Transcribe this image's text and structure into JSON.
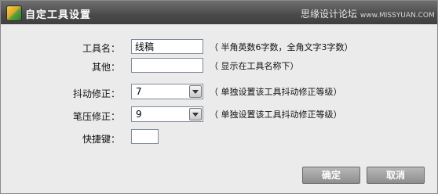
{
  "window": {
    "title": "自定工具设置",
    "watermark": "思缘设计论坛",
    "watermark_sub": "www.MISSYUAN.COM"
  },
  "form": {
    "tool_name": {
      "label": "工具名：",
      "value": "线稿",
      "hint": "（ 半角英数6字数，全角文字3字数）"
    },
    "other": {
      "label": "其他：",
      "value": "",
      "hint": "（ 显示在工具名称下）"
    },
    "stabilizer": {
      "label": "抖动修正：",
      "value": "7",
      "hint": "（ 单独设置该工具抖动修正等级）"
    },
    "pressure": {
      "label": "笔压修正：",
      "value": "9",
      "hint": "（ 单独设置该工具抖动修正等级）"
    },
    "shortcut": {
      "label": "快捷键：",
      "value": ""
    }
  },
  "buttons": {
    "ok": "确定",
    "cancel": "取消"
  }
}
